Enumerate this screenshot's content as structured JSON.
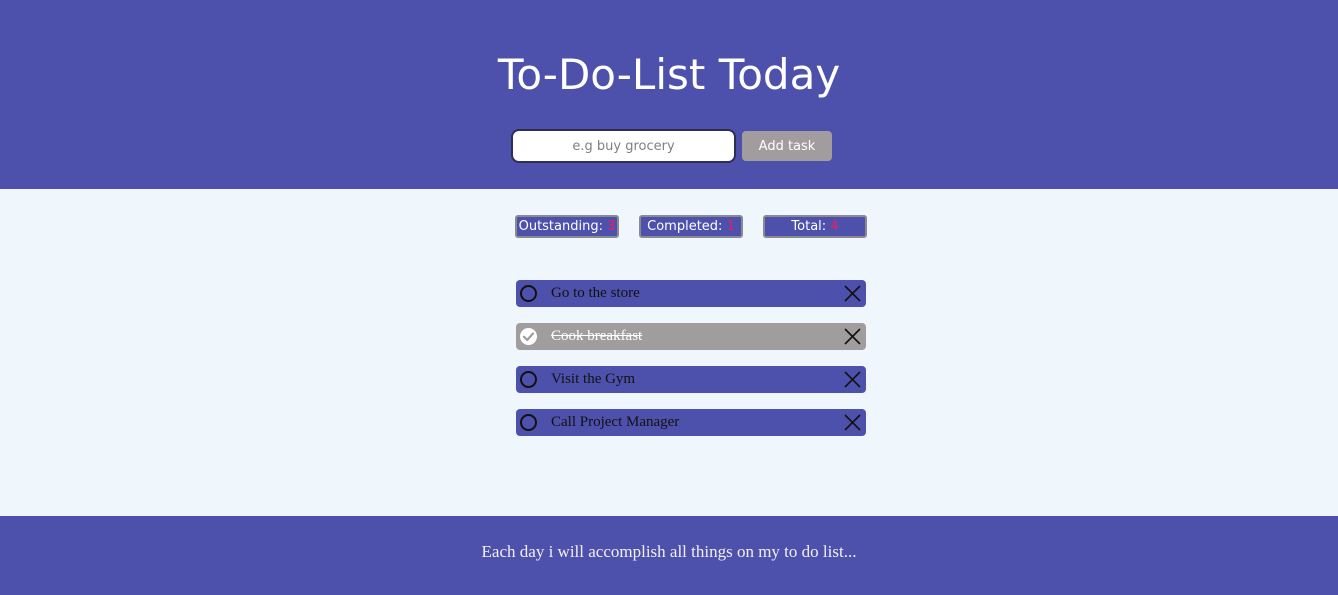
{
  "header": {
    "title": "To-Do-List Today",
    "input_placeholder": "e.g buy grocery",
    "input_value": "",
    "add_button_label": "Add task"
  },
  "counters": {
    "outstanding_label": "Outstanding: ",
    "outstanding_value": "3",
    "completed_label": "Completed: ",
    "completed_value": "1",
    "total_label": "Total: ",
    "total_value": "4"
  },
  "tasks": [
    {
      "label": "Go to the store",
      "completed": false
    },
    {
      "label": "Cook breakfast",
      "completed": true
    },
    {
      "label": "Visit the Gym",
      "completed": false
    },
    {
      "label": "Call Project Manager",
      "completed": false
    }
  ],
  "footer": {
    "text": "Each day i will accomplish all things on my to do list..."
  },
  "colors": {
    "brand": "#4e51ab",
    "background": "#eff7fd",
    "completed_task": "#a19d9e",
    "counter_number": "#e91e63",
    "button": "#a19d9e"
  },
  "icons": {
    "open_task": "circle-icon",
    "completed_task": "check-circle-icon",
    "delete": "close-icon"
  }
}
